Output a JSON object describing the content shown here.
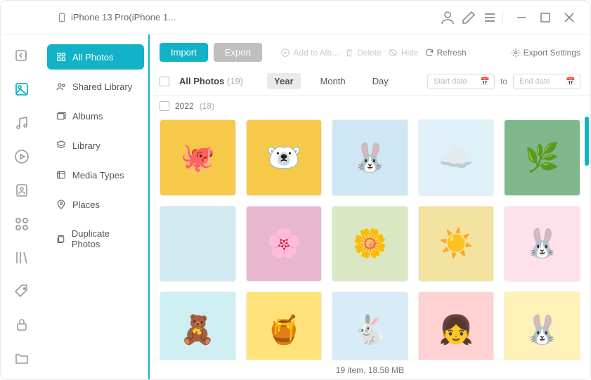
{
  "titlebar": {
    "device_name": "iPhone 13 Pro(iPhone 1..."
  },
  "rail": {
    "items": [
      {
        "name": "back-icon"
      },
      {
        "name": "photos-icon",
        "active": true
      },
      {
        "name": "music-icon"
      },
      {
        "name": "videos-icon"
      },
      {
        "name": "contacts-icon"
      },
      {
        "name": "apps-icon"
      },
      {
        "name": "books-icon"
      },
      {
        "name": "tags-icon"
      },
      {
        "name": "security-icon"
      },
      {
        "name": "files-icon"
      }
    ]
  },
  "sidebar": {
    "items": [
      {
        "icon": "grid-icon",
        "label": "All Photos",
        "active": true
      },
      {
        "icon": "shared-icon",
        "label": "Shared Library"
      },
      {
        "icon": "albums-icon",
        "label": "Albums"
      },
      {
        "icon": "library-icon",
        "label": "Library"
      },
      {
        "icon": "media-types-icon",
        "label": "Media Types"
      },
      {
        "icon": "places-icon",
        "label": "Places"
      },
      {
        "icon": "duplicates-icon",
        "label": "Duplicate Photos"
      }
    ]
  },
  "toolbar": {
    "import_label": "Import",
    "export_label": "Export",
    "add_label": "Add to Alb...",
    "delete_label": "Delete",
    "hide_label": "Hide",
    "refresh_label": "Refresh",
    "export_settings_label": "Export Settings"
  },
  "filter": {
    "all_label": "All Photos",
    "all_count": "(19)",
    "seg_year": "Year",
    "seg_month": "Month",
    "seg_day": "Day",
    "start_placeholder": "Start date",
    "to_label": "to",
    "end_placeholder": "End date"
  },
  "group": {
    "year": "2022",
    "count": "(18)"
  },
  "thumbs": [
    {
      "bg": "#f7c948",
      "emoji": "🐙"
    },
    {
      "bg": "#f7c948",
      "emoji": "🐻‍❄️"
    },
    {
      "bg": "#cfe7f5",
      "emoji": "🐰"
    },
    {
      "bg": "#dff1f8",
      "emoji": "☁️"
    },
    {
      "bg": "#7fb88a",
      "emoji": "🌿"
    },
    {
      "bg": "#cfeaf0",
      "emoji": ""
    },
    {
      "bg": "#e8b7cf",
      "emoji": "🌸"
    },
    {
      "bg": "#d9e8c2",
      "emoji": "🌼"
    },
    {
      "bg": "#f3e2a0",
      "emoji": "☀️"
    },
    {
      "bg": "#ffe1ec",
      "emoji": "🐰"
    },
    {
      "bg": "#cdeff2",
      "emoji": "🧸"
    },
    {
      "bg": "#ffe37a",
      "emoji": "🍯"
    },
    {
      "bg": "#d7ecf7",
      "emoji": "🐇"
    },
    {
      "bg": "#ffd3d3",
      "emoji": "👧"
    },
    {
      "bg": "#fff1b8",
      "emoji": "🐰"
    }
  ],
  "status": {
    "text": "19 item, 18.58 MB"
  }
}
